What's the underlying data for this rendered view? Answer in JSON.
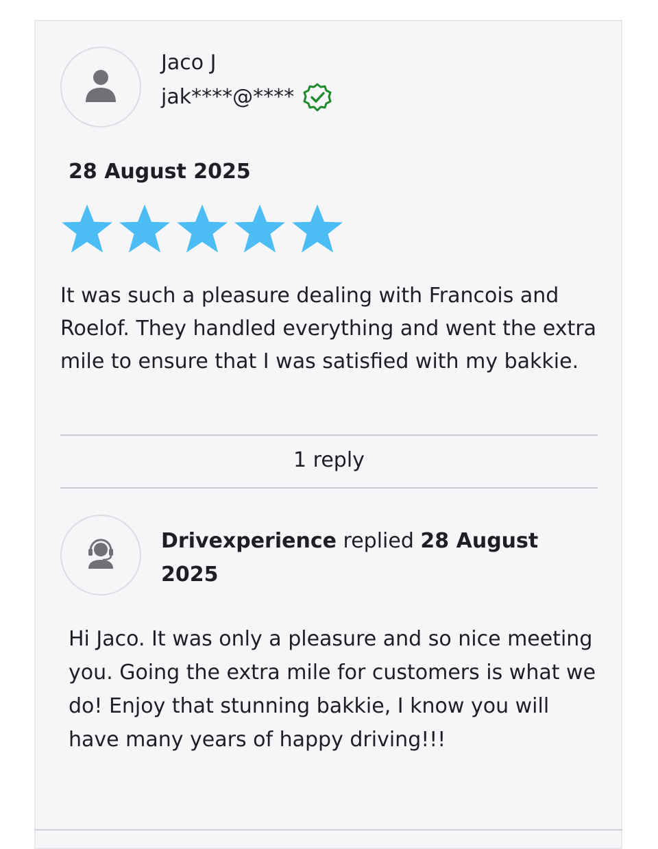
{
  "review": {
    "reviewer_name": "Jaco J",
    "reviewer_email": "jak****@****",
    "verified_icon": "verified-badge-icon",
    "date": "28 August 2025",
    "rating": 5,
    "rating_max": 5,
    "star_color": "#4cbcf5",
    "text": "It was such a pleasure dealing with Francois and Roelof. They handled everything and went the extra mile to ensure that I was satisfied with my bakkie."
  },
  "replies": {
    "count_label": "1 reply",
    "items": [
      {
        "author": "Drivexperience",
        "action": "replied",
        "date": "28 August 2025",
        "text": "Hi Jaco. It was only a pleasure and so nice meeting you. Going the extra mile for customers is what we do! Enjoy that stunning bakkie, I know you will have many years of happy driving!!!"
      }
    ]
  },
  "colors": {
    "verified_green": "#1f8a2c",
    "icon_gray": "#707077",
    "card_background": "#f6f6f8"
  }
}
